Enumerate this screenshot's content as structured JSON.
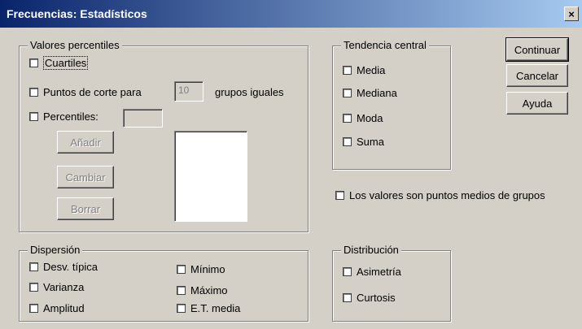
{
  "window": {
    "title": "Frecuencias: Estadísticos",
    "close_label": "×"
  },
  "percentiles": {
    "legend": "Valores percentiles",
    "cuartiles": "Cuartiles",
    "puntos_de_corte": "Puntos de corte para",
    "grupos_value": "10",
    "grupos_label": "grupos iguales",
    "percentiles_label": "Percentiles:",
    "anadir": "Añadir",
    "cambiar": "Cambiar",
    "borrar": "Borrar"
  },
  "tendencia": {
    "legend": "Tendencia central",
    "media": "Media",
    "mediana": "Mediana",
    "moda": "Moda",
    "suma": "Suma"
  },
  "buttons": {
    "continuar": "Continuar",
    "cancelar": "Cancelar",
    "ayuda": "Ayuda"
  },
  "medios_grupos": "Los valores son puntos medios de grupos",
  "dispersion": {
    "legend": "Dispersión",
    "desv_tipica": "Desv. típica",
    "varianza": "Varianza",
    "amplitud": "Amplitud",
    "minimo": "Mínimo",
    "maximo": "Máximo",
    "et_media": "E.T. media"
  },
  "distribucion": {
    "legend": "Distribución",
    "asimetria": "Asimetría",
    "curtosis": "Curtosis"
  }
}
